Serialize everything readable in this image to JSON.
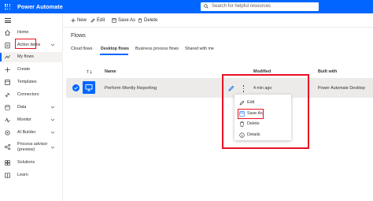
{
  "app": {
    "title": "Power Automate"
  },
  "search": {
    "placeholder": "Search for helpful resources"
  },
  "sidebar": {
    "items": [
      {
        "label": "Home",
        "icon": "home-icon"
      },
      {
        "label": "Action items",
        "icon": "clipboard-icon",
        "chevron": true
      },
      {
        "label": "My flows",
        "icon": "flow-icon",
        "active": true
      },
      {
        "label": "Create",
        "icon": "plus-icon"
      },
      {
        "label": "Templates",
        "icon": "template-icon"
      },
      {
        "label": "Connectors",
        "icon": "connector-icon"
      },
      {
        "label": "Data",
        "icon": "database-icon",
        "chevron": true
      },
      {
        "label": "Monitor",
        "icon": "monitor-icon",
        "chevron": true
      },
      {
        "label": "AI Builder",
        "icon": "ai-builder-icon",
        "chevron": true
      },
      {
        "label": "Process advisor (preview)",
        "icon": "process-advisor-icon",
        "chevron": true
      },
      {
        "label": "Solutions",
        "icon": "solutions-icon"
      },
      {
        "label": "Learn",
        "icon": "book-icon"
      }
    ]
  },
  "commands": {
    "new": "New",
    "edit": "Edit",
    "save_as": "Save As",
    "delete": "Delete"
  },
  "page": {
    "title": "Flows",
    "tabs": [
      "Cloud flows",
      "Desktop flows",
      "Business process flows",
      "Shared with me"
    ],
    "selected_tab": "Desktop flows"
  },
  "table": {
    "columns": {
      "name": "Name",
      "modified": "Modified",
      "built_with": "Built with"
    },
    "rows": [
      {
        "name": "Perform Montly Reporting",
        "modified": "4 min ago",
        "built_with": "Power Automate Desktop",
        "selected": true
      }
    ]
  },
  "context_menu": {
    "items": [
      {
        "label": "Edit",
        "icon": "pencil-icon"
      },
      {
        "label": "Save As",
        "icon": "save-as-icon"
      },
      {
        "label": "Delete",
        "icon": "trash-icon"
      },
      {
        "label": "Details",
        "icon": "info-icon"
      }
    ]
  },
  "colors": {
    "accent": "#0066ff",
    "highlight": "#e81123",
    "row_selected": "#edebe9"
  }
}
